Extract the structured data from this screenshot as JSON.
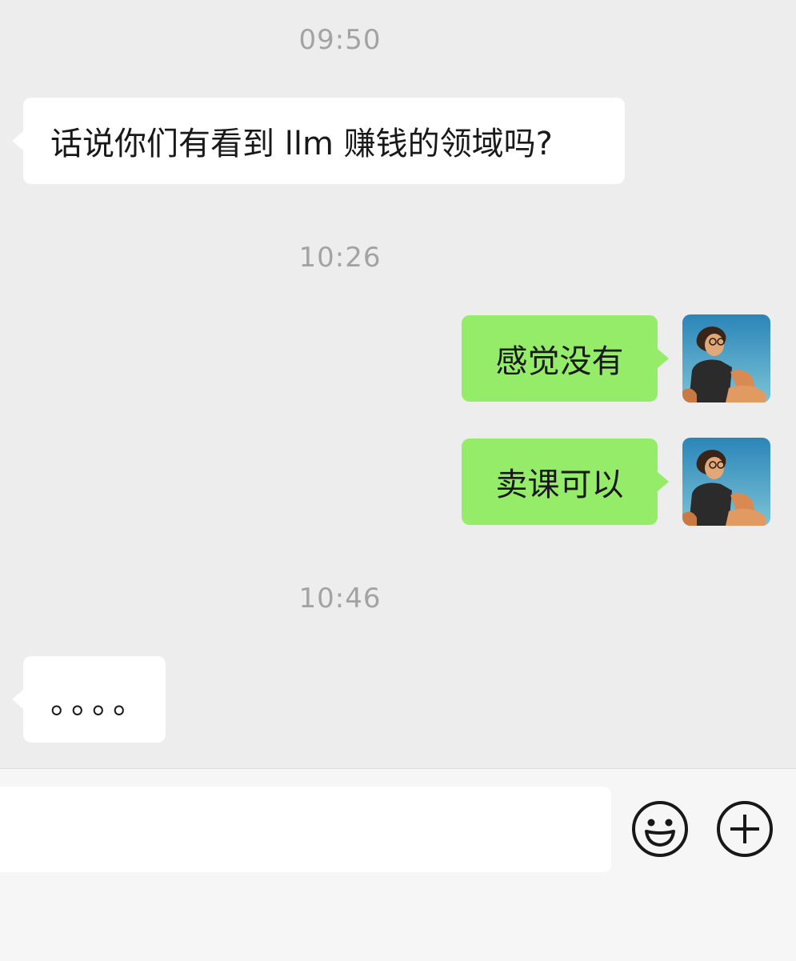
{
  "messages": [
    {
      "type": "time",
      "text": "09:50"
    },
    {
      "type": "in",
      "text": "话说你们有看到 llm 赚钱的领域吗?"
    },
    {
      "type": "time",
      "text": "10:26"
    },
    {
      "type": "out",
      "text": "感觉没有"
    },
    {
      "type": "out",
      "text": "卖课可以"
    },
    {
      "type": "time",
      "text": "10:46"
    },
    {
      "type": "in",
      "text": "。。。。"
    }
  ],
  "input_bar": {
    "input_value": "",
    "emoji_icon": "emoji-icon",
    "plus_icon": "plus-icon"
  },
  "colors": {
    "background": "#ededed",
    "incoming_bubble": "#ffffff",
    "outgoing_bubble": "#95ec69",
    "timestamp": "#a3a3a3"
  }
}
